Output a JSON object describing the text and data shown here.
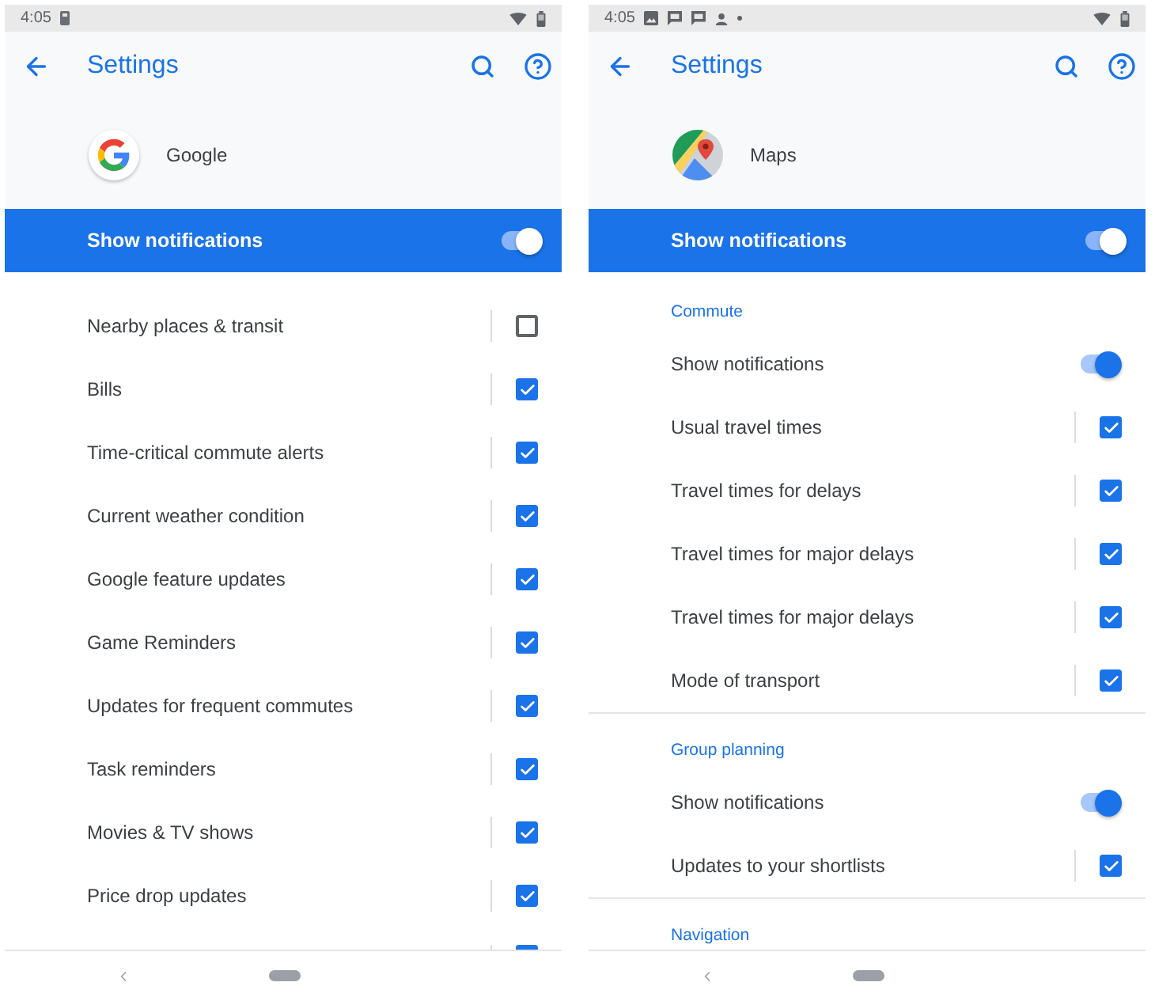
{
  "phones": [
    {
      "status_bar": {
        "time": "4:05",
        "notification_icons": [
          {
            "kind": "storage"
          }
        ]
      },
      "header": {
        "title": "Settings"
      },
      "app": {
        "name": "Google",
        "kind": "google"
      },
      "master_switch": {
        "label": "Show notifications",
        "on": true
      },
      "sections": [
        {
          "items": [
            {
              "kind": "checkbox",
              "label": "Nearby places & transit",
              "checked": false
            },
            {
              "kind": "checkbox",
              "label": "Bills",
              "checked": true
            },
            {
              "kind": "checkbox",
              "label": "Time-critical commute alerts",
              "checked": true
            },
            {
              "kind": "checkbox",
              "label": "Current weather condition",
              "checked": true
            },
            {
              "kind": "checkbox",
              "label": "Google feature updates",
              "checked": true
            },
            {
              "kind": "checkbox",
              "label": "Game Reminders",
              "checked": true
            },
            {
              "kind": "checkbox",
              "label": "Updates for frequent commutes",
              "checked": true
            },
            {
              "kind": "checkbox",
              "label": "Task reminders",
              "checked": true
            },
            {
              "kind": "checkbox",
              "label": "Movies & TV shows",
              "checked": true
            },
            {
              "kind": "checkbox",
              "label": "Price drop updates",
              "checked": true
            },
            {
              "kind": "checkbox",
              "checked": true
            }
          ]
        }
      ]
    },
    {
      "status_bar": {
        "time": "4:05",
        "notification_icons": [
          {
            "kind": "image"
          },
          {
            "kind": "message"
          },
          {
            "kind": "message"
          },
          {
            "kind": "person"
          },
          {
            "kind": "dot"
          }
        ]
      },
      "header": {
        "title": "Settings"
      },
      "app": {
        "name": "Maps",
        "kind": "maps"
      },
      "master_switch": {
        "label": "Show notifications",
        "on": true
      },
      "sections": [
        {
          "title": "Commute",
          "items": [
            {
              "kind": "switch",
              "label": "Show notifications",
              "on": true
            },
            {
              "kind": "checkbox",
              "label": "Usual travel times",
              "checked": true
            },
            {
              "kind": "checkbox",
              "label": "Travel times for delays",
              "checked": true
            },
            {
              "kind": "checkbox",
              "label": "Travel times for major delays",
              "checked": true
            },
            {
              "kind": "checkbox",
              "label": "Travel times for major delays",
              "checked": true
            },
            {
              "kind": "checkbox",
              "label": "Mode of transport",
              "checked": true
            }
          ]
        },
        {
          "title": "Group planning",
          "items": [
            {
              "kind": "switch",
              "label": "Show notifications",
              "on": true
            },
            {
              "kind": "checkbox",
              "label": "Updates to your shortlists",
              "checked": true
            }
          ]
        },
        {
          "title": "Navigation"
        }
      ]
    }
  ]
}
